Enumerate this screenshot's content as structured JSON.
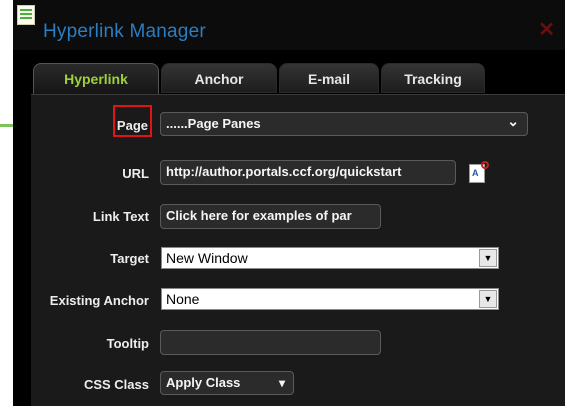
{
  "window": {
    "title": "Hyperlink Manager",
    "close_symbol": "✕"
  },
  "tabs": [
    {
      "label": "Hyperlink",
      "active": true
    },
    {
      "label": "Anchor",
      "active": false
    },
    {
      "label": "E-mail",
      "active": false
    },
    {
      "label": "Tracking",
      "active": false
    }
  ],
  "form": {
    "page": {
      "label": "Page",
      "value": "......Page Panes"
    },
    "url": {
      "label": "URL",
      "value": "http://author.portals.ccf.org/quickstart"
    },
    "link_text": {
      "label": "Link Text",
      "value": "Click here for examples of par"
    },
    "target": {
      "label": "Target",
      "value": "New Window"
    },
    "existing_anchor": {
      "label": "Existing Anchor",
      "value": "None"
    },
    "tooltip": {
      "label": "Tooltip",
      "value": ""
    },
    "css_class": {
      "label": "CSS Class",
      "value": "Apply Class"
    }
  },
  "icons": {
    "chevron": "⌄",
    "dropdown_arrow": "▼",
    "css_arrow": "▾",
    "doc_glyph": "A"
  },
  "colors": {
    "accent_green": "#9ed13a",
    "title_blue": "#2c7ec2",
    "annotation_red": "#e01414",
    "arrow_green": "#7ec35a"
  }
}
